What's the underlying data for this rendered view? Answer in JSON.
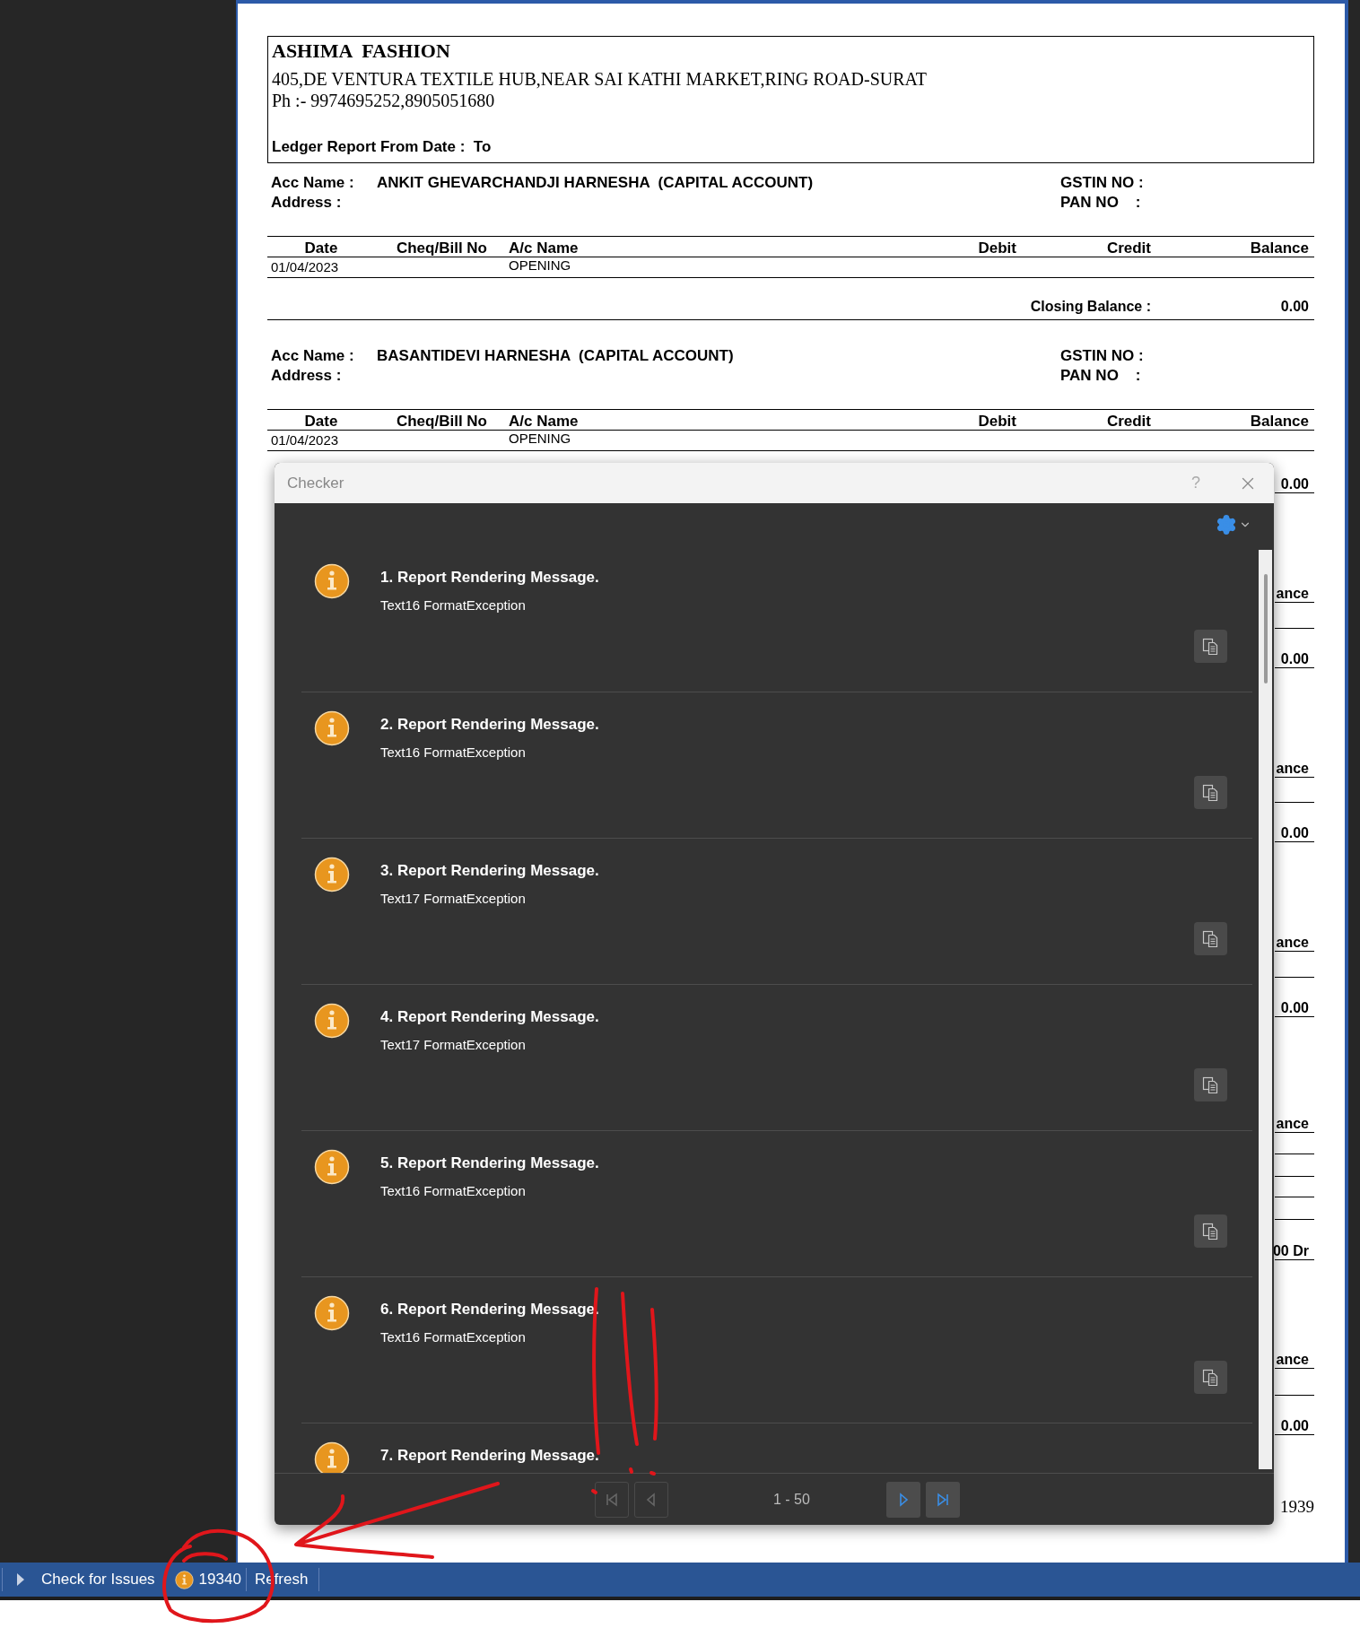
{
  "report": {
    "company": "ASHIMA  FASHION",
    "address": "405,DE VENTURA TEXTILE HUB,NEAR SAI KATHI MARKET,RING ROAD-SURAT",
    "phone": "Ph :- 9974695252,8905051680",
    "report_title": "Ledger Report From Date :  To",
    "accounts": [
      {
        "acc_name_label": "Acc Name :",
        "acc_name": "ANKIT GHEVARCHANDJI HARNESHA  (CAPITAL ACCOUNT)",
        "address_label": "Address :",
        "gstin_label": "GSTIN NO :",
        "pan_label": "PAN NO    :",
        "columns": [
          "Date",
          "Cheq/Bill No",
          "A/c Name",
          "Debit",
          "Credit",
          "Balance"
        ],
        "rows": [
          {
            "date": "01/04/2023",
            "ac_name": "OPENING"
          }
        ],
        "closing_balance_label": "Closing Balance :",
        "closing_balance": "0.00"
      },
      {
        "acc_name_label": "Acc Name :",
        "acc_name": "BASANTIDEVI HARNESHA  (CAPITAL ACCOUNT)",
        "address_label": "Address :",
        "gstin_label": "GSTIN NO :",
        "pan_label": "PAN NO    :",
        "columns": [
          "Date",
          "Cheq/Bill No",
          "A/c Name",
          "Debit",
          "Credit",
          "Balance"
        ],
        "rows": [
          {
            "date": "01/04/2023",
            "ac_name": "OPENING"
          }
        ]
      }
    ],
    "covered_fragments": [
      {
        "kind": "cell",
        "text": "0.00"
      },
      {
        "kind": "cell",
        "text": "ance"
      },
      {
        "kind": "cell",
        "text": "0.00"
      },
      {
        "kind": "cell",
        "text": "ance"
      },
      {
        "kind": "cell",
        "text": "0.00"
      },
      {
        "kind": "cell",
        "text": "ance"
      },
      {
        "kind": "cell",
        "text": "0.00"
      },
      {
        "kind": "cell",
        "text": "ance"
      },
      {
        "kind": "cell",
        "text": "00 Dr"
      },
      {
        "kind": "cell",
        "text": "ance"
      },
      {
        "kind": "cell",
        "text": "0.00"
      },
      {
        "kind": "page_total",
        "text": "1939"
      }
    ]
  },
  "checker": {
    "title": "Checker",
    "help": "?",
    "messages": [
      {
        "title": "1. Report Rendering Message.",
        "detail": "Text16 FormatException"
      },
      {
        "title": "2. Report Rendering Message.",
        "detail": "Text16 FormatException"
      },
      {
        "title": "3. Report Rendering Message.",
        "detail": "Text17 FormatException"
      },
      {
        "title": "4. Report Rendering Message.",
        "detail": "Text17 FormatException"
      },
      {
        "title": "5. Report Rendering Message.",
        "detail": "Text16 FormatException"
      },
      {
        "title": "6. Report Rendering Message.",
        "detail": "Text16 FormatException"
      },
      {
        "title": "7. Report Rendering Message."
      }
    ],
    "pagination": {
      "range": "1 - 50",
      "buttons": [
        {
          "kind": "first",
          "disabled": true
        },
        {
          "kind": "prev",
          "disabled": true
        },
        {
          "kind": "next",
          "disabled": false
        },
        {
          "kind": "last",
          "disabled": false
        }
      ]
    }
  },
  "status_bar": {
    "check_label": "Check for Issues",
    "issue_count": "19340",
    "refresh_label": "Refresh"
  }
}
